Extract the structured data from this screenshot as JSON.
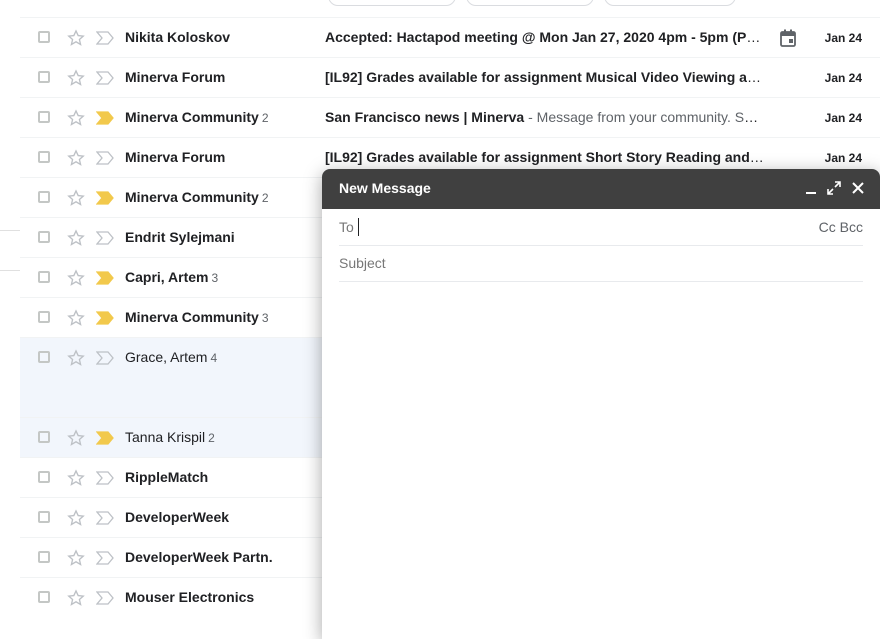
{
  "compose": {
    "title": "New Message",
    "to_label": "To",
    "cc_bcc": "Cc Bcc",
    "subject_placeholder": "Subject"
  },
  "emails": [
    {
      "sender": "Nikita Koloskov",
      "count": "",
      "subject": "Accepted: Hactapod meeting @ Mon Jan 27, 2020 4pm - 5pm (PS...",
      "snippet": "",
      "date": "Jan 24",
      "unread": true,
      "important": false
    },
    {
      "sender": "Minerva Forum",
      "count": "",
      "subject": "[IL92] Grades available for assignment Musical Video Viewing and ...",
      "snippet": "",
      "date": "Jan 24",
      "unread": true,
      "important": false
    },
    {
      "sender": "Minerva Community",
      "count": "2",
      "subject": "San Francisco news | Minerva",
      "snippet": " - Message from your community. SA...",
      "date": "Jan 24",
      "unread": true,
      "important": true
    },
    {
      "sender": "Minerva Forum",
      "count": "",
      "subject": "[IL92] Grades available for assignment Short Story Reading and Re...",
      "snippet": "",
      "date": "Jan 24",
      "unread": true,
      "important": false
    },
    {
      "sender": "Minerva Community",
      "count": "2",
      "subject": "",
      "snippet": "",
      "date": "",
      "unread": true,
      "important": true
    },
    {
      "sender": "Endrit Sylejmani",
      "count": "",
      "subject": "",
      "snippet": "",
      "date": "",
      "unread": true,
      "important": false
    },
    {
      "sender": "Capri, Artem",
      "count": "3",
      "subject": "",
      "snippet": "",
      "date": "",
      "unread": true,
      "important": true
    },
    {
      "sender": "Minerva Community",
      "count": "3",
      "subject": "",
      "snippet": "",
      "date": "",
      "unread": true,
      "important": true
    },
    {
      "sender": "Grace, Artem",
      "count": "4",
      "subject": "",
      "snippet": "",
      "date": "",
      "unread": false,
      "important": false
    },
    {
      "sender": "Tanna Krispil",
      "count": "2",
      "subject": "",
      "snippet": "",
      "date": "",
      "unread": false,
      "important": true
    },
    {
      "sender": "RippleMatch",
      "count": "",
      "subject": "",
      "snippet": "",
      "date": "",
      "unread": true,
      "important": false
    },
    {
      "sender": "DeveloperWeek",
      "count": "",
      "subject": "",
      "snippet": "",
      "date": "",
      "unread": true,
      "important": false
    },
    {
      "sender": "DeveloperWeek Partn.",
      "count": "",
      "subject": "",
      "snippet": "",
      "date": "",
      "unread": true,
      "important": false
    },
    {
      "sender": "Mouser Electronics",
      "count": "",
      "subject": "",
      "snippet": "",
      "date": "",
      "unread": true,
      "important": false
    }
  ],
  "colors": {
    "important": "#f2c94c",
    "compose_header": "#404040"
  }
}
